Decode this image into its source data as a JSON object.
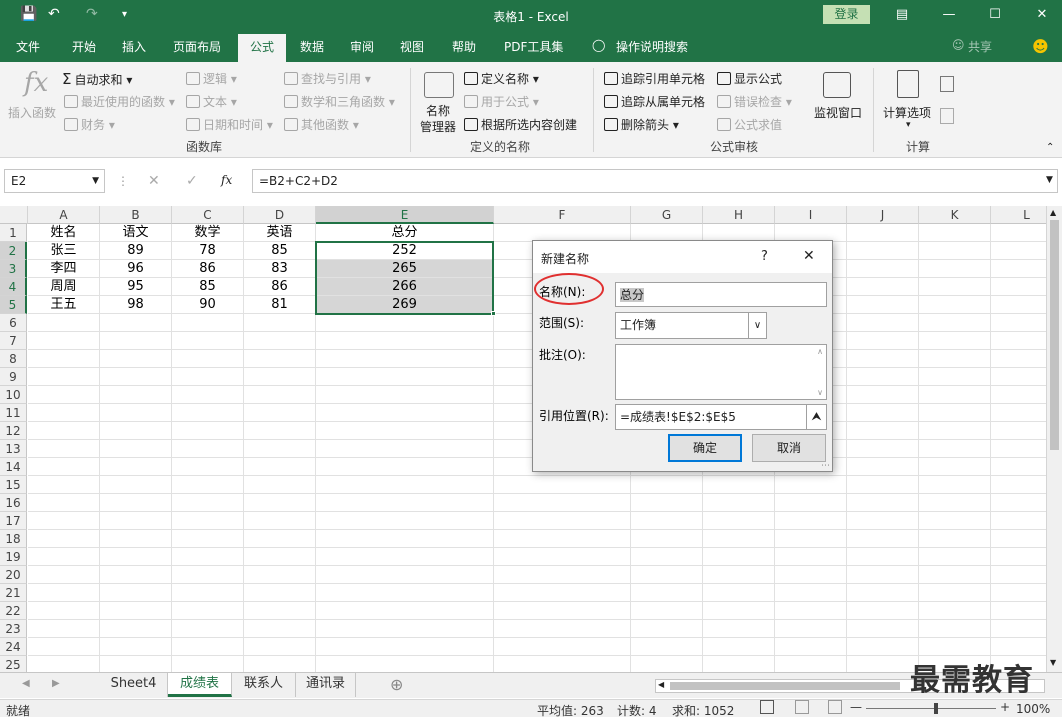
{
  "window": {
    "title": "表格1 - Excel",
    "login": "登录"
  },
  "tabs": [
    "文件",
    "开始",
    "插入",
    "页面布局",
    "公式",
    "数据",
    "审阅",
    "视图",
    "帮助",
    "PDF工具集",
    "操作说明搜索"
  ],
  "share": "共享",
  "ribbon": {
    "insert_func": "插入函数",
    "autosum": "自动求和",
    "recent": "最近使用的函数",
    "finance": "财务",
    "logic": "逻辑",
    "text": "文本",
    "datetime": "日期和时间",
    "lookup": "查找与引用",
    "math": "数学和三角函数",
    "other": "其他函数",
    "group_lib": "函数库",
    "name_mgr1": "名称",
    "name_mgr2": "管理器",
    "define_name": "定义名称",
    "use_in_formula": "用于公式",
    "create_from_sel": "根据所选内容创建",
    "group_names": "定义的名称",
    "trace_prec": "追踪引用单元格",
    "trace_dep": "追踪从属单元格",
    "remove_arrows": "删除箭头",
    "show_formulas": "显示公式",
    "error_check": "错误检查",
    "eval_formula": "公式求值",
    "group_audit": "公式审核",
    "watch_window": "监视窗口",
    "calc_options": "计算选项",
    "group_calc": "计算"
  },
  "formula": {
    "namebox": "E2",
    "fx": "fx",
    "content": "=B2+C2+D2"
  },
  "columns": [
    "A",
    "B",
    "C",
    "D",
    "E",
    "F",
    "G",
    "H",
    "I",
    "J",
    "K",
    "L"
  ],
  "rows": [
    "1",
    "2",
    "3",
    "4",
    "5",
    "6",
    "7",
    "8",
    "9",
    "10",
    "11",
    "12",
    "13",
    "14",
    "15",
    "16",
    "17",
    "18",
    "19",
    "20",
    "21",
    "22",
    "23",
    "24",
    "25"
  ],
  "table": [
    [
      "姓名",
      "语文",
      "数学",
      "英语",
      "总分"
    ],
    [
      "张三",
      "89",
      "78",
      "85",
      "252"
    ],
    [
      "李四",
      "96",
      "86",
      "83",
      "265"
    ],
    [
      "周周",
      "95",
      "85",
      "86",
      "266"
    ],
    [
      "王五",
      "98",
      "90",
      "81",
      "269"
    ]
  ],
  "sheets": [
    "Sheet4",
    "成绩表",
    "联系人",
    "通讯录"
  ],
  "status": {
    "ready": "就绪",
    "avg": "平均值: 263",
    "count": "计数: 4",
    "sum": "求和: 1052",
    "zoom": "100%"
  },
  "dialog": {
    "title": "新建名称",
    "help": "?",
    "close": "✕",
    "name_label": "名称(N):",
    "name_value": "总分",
    "scope_label": "范围(S):",
    "scope_value": "工作簿",
    "comment_label": "批注(O):",
    "ref_label": "引用位置(R):",
    "ref_value": "=成绩表!$E$2:$E$5",
    "ok": "确定",
    "cancel": "取消"
  },
  "watermark": "最需教育",
  "colors": {
    "excel_green": "#217346",
    "highlight_ring": "#e03030"
  }
}
